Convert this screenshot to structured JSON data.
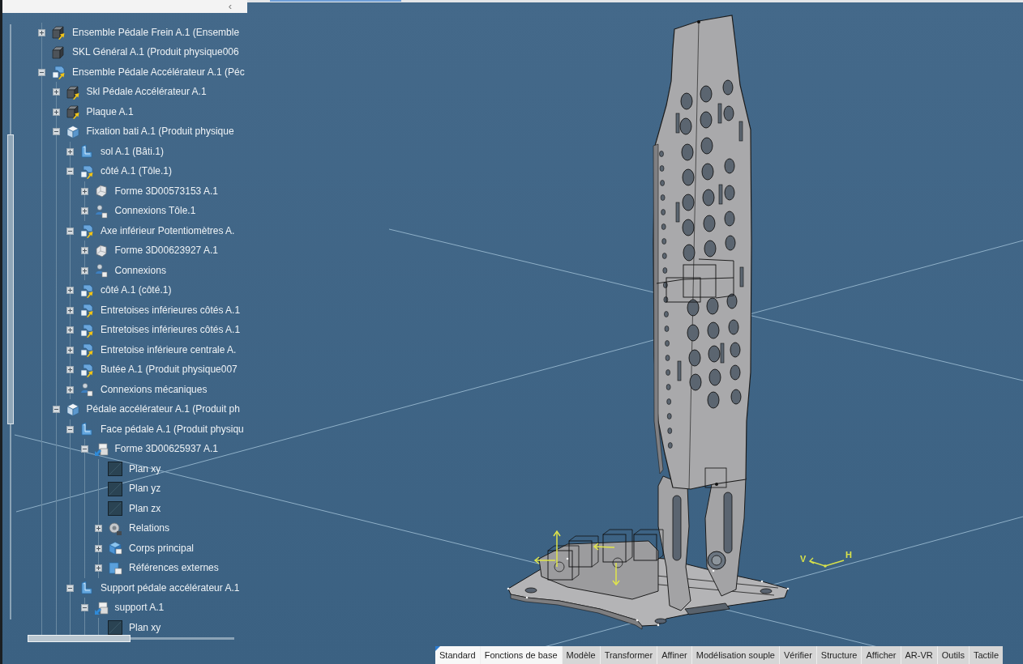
{
  "tree_panel": {
    "collapse_button": "‹",
    "items": [
      {
        "label": "Ensemble Pédale Frein A.1 (Ensemble",
        "kind": "assembly",
        "expanded": false,
        "selected": false
      },
      {
        "label": "SKL Général A.1 (Produit physique006",
        "kind": "skeleton",
        "selected": false
      },
      {
        "label": "Ensemble Pédale Accélérateur A.1 (Péc",
        "kind": "product_ref",
        "expanded": true,
        "selected": false,
        "children": [
          {
            "label": "Skl Pédale Accélérateur A.1",
            "kind": "assembly",
            "expanded": false,
            "selected": false
          },
          {
            "label": "Plaque A.1",
            "kind": "assembly",
            "expanded": false,
            "selected": false
          },
          {
            "label": "Fixation bati A.1 (Produit physique",
            "kind": "product",
            "expanded": true,
            "selected": false,
            "children": [
              {
                "label": "sol A.1 (Bâti.1)",
                "kind": "physical",
                "expanded": false,
                "selected": false
              },
              {
                "label": "côté A.1 (Tôle.1)",
                "kind": "product_ref",
                "expanded": true,
                "selected": false,
                "children": [
                  {
                    "label": "Forme 3D00573153 A.1",
                    "kind": "shape",
                    "expanded": false,
                    "selected": false
                  },
                  {
                    "label": "Connexions Tôle.1",
                    "kind": "connections",
                    "expanded": false,
                    "selected": false
                  }
                ]
              },
              {
                "label": "Axe inférieur Potentiomètres A.",
                "kind": "product_ref",
                "expanded": true,
                "selected": false,
                "children": [
                  {
                    "label": "Forme 3D00623927 A.1",
                    "kind": "shape",
                    "expanded": false,
                    "selected": false
                  },
                  {
                    "label": "Connexions",
                    "kind": "connections",
                    "expanded": false,
                    "selected": false
                  }
                ]
              },
              {
                "label": "côté A.1 (côté.1)",
                "kind": "product_ref",
                "expanded": false,
                "selected": false
              },
              {
                "label": "Entretoises inférieures côtés A.1",
                "kind": "product_ref",
                "expanded": false,
                "selected": false
              },
              {
                "label": "Entretoises inférieures côtés A.1",
                "kind": "product_ref",
                "expanded": false,
                "selected": false
              },
              {
                "label": "Entretoise inférieure centrale A.",
                "kind": "product_ref",
                "expanded": false,
                "selected": false
              },
              {
                "label": "Butée A.1 (Produit physique007",
                "kind": "product_ref",
                "expanded": false,
                "selected": false
              },
              {
                "label": "Connexions mécaniques",
                "kind": "connections",
                "expanded": false,
                "selected": false
              }
            ]
          },
          {
            "label": "Pédale accélérateur A.1 (Produit ph",
            "kind": "product",
            "expanded": true,
            "selected": false,
            "children": [
              {
                "label": "Face pédale A.1 (Produit physiqu",
                "kind": "physical",
                "expanded": true,
                "selected": false,
                "children": [
                  {
                    "label": "Forme 3D00625937 A.1",
                    "kind": "part",
                    "expanded": true,
                    "selected": false,
                    "children": [
                      {
                        "label": "Plan xy",
                        "kind": "plane",
                        "selected": false
                      },
                      {
                        "label": "Plan yz",
                        "kind": "plane",
                        "selected": false
                      },
                      {
                        "label": "Plan zx",
                        "kind": "plane",
                        "selected": false
                      },
                      {
                        "label": "Relations",
                        "kind": "relations",
                        "expanded": false,
                        "selected": false
                      },
                      {
                        "label": "Corps principal",
                        "kind": "body",
                        "expanded": false,
                        "selected": false
                      },
                      {
                        "label": "Références externes",
                        "kind": "references",
                        "expanded": false,
                        "selected": false
                      }
                    ]
                  }
                ]
              },
              {
                "label": "Support pédale accélérateur A.1",
                "kind": "physical",
                "expanded": true,
                "selected": false,
                "children": [
                  {
                    "label": "support A.1",
                    "kind": "part",
                    "expanded": true,
                    "selected": false,
                    "children": [
                      {
                        "label": "Plan xy",
                        "kind": "plane",
                        "selected": false
                      }
                    ]
                  }
                ]
              }
            ]
          }
        ]
      }
    ]
  },
  "viewport": {
    "orientation_marker": {
      "labels": [
        "V",
        "H"
      ]
    }
  },
  "toolbar_tabs": [
    {
      "label": "Standard",
      "selected": true,
      "hovered": false
    },
    {
      "label": "Fonctions de base",
      "selected": false,
      "hovered": true
    },
    {
      "label": "Modèle",
      "selected": false,
      "hovered": false
    },
    {
      "label": "Transformer",
      "selected": false,
      "hovered": false
    },
    {
      "label": "Affiner",
      "selected": false,
      "hovered": false
    },
    {
      "label": "Modélisation souple",
      "selected": false,
      "hovered": false
    },
    {
      "label": "Vérifier",
      "selected": false,
      "hovered": false
    },
    {
      "label": "Structure",
      "selected": false,
      "hovered": false
    },
    {
      "label": "Afficher",
      "selected": false,
      "hovered": false
    },
    {
      "label": "AR-VR",
      "selected": false,
      "hovered": false
    },
    {
      "label": "Outils",
      "selected": false,
      "hovered": false
    },
    {
      "label": "Tactile",
      "selected": false,
      "hovered": false
    }
  ]
}
